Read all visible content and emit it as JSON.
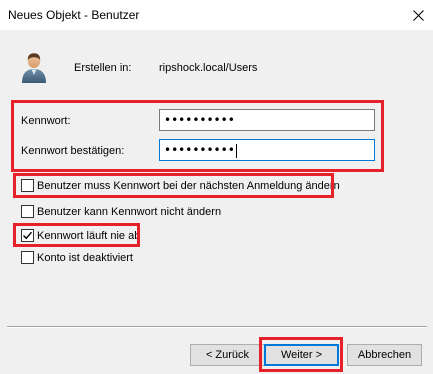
{
  "window": {
    "title": "Neues Objekt - Benutzer",
    "close_icon": "close-icon"
  },
  "header": {
    "avatar_icon": "user-avatar-icon",
    "create_in_label": "Erstellen in:",
    "create_in_value": "ripshock.local/Users"
  },
  "password": {
    "label": "Kennwort:",
    "value": "••••••••••",
    "confirm_label": "Kennwort bestätigen:",
    "confirm_value": "••••••••••"
  },
  "options": [
    {
      "label": "Benutzer muss Kennwort bei der nächsten Anmeldung ändern",
      "checked": false
    },
    {
      "label": "Benutzer kann Kennwort nicht ändern",
      "checked": false
    },
    {
      "label": "Kennwort läuft nie ab",
      "checked": true
    },
    {
      "label": "Konto ist deaktiviert",
      "checked": false
    }
  ],
  "buttons": {
    "back": "< Zurück",
    "next": "Weiter >",
    "cancel": "Abbrechen"
  },
  "colors": {
    "highlight": "#e8202a",
    "focus": "#0078d7"
  }
}
